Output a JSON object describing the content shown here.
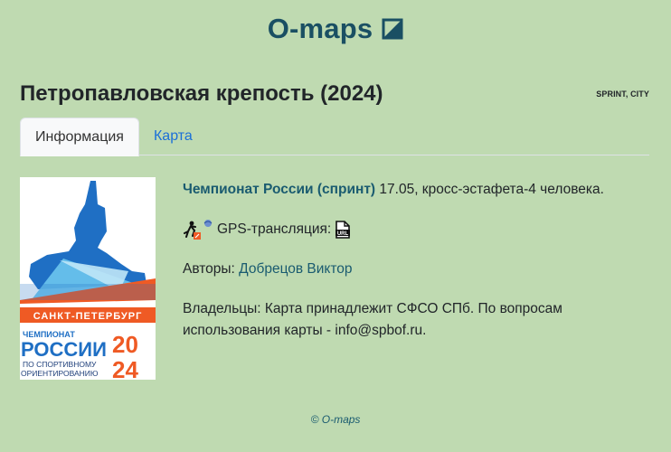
{
  "header": {
    "brand": "O-maps",
    "brand_icon": "half-square-icon"
  },
  "event": {
    "title": "Петропавловская крепость (2024)",
    "tags": "SPRINT, CITY"
  },
  "tabs": [
    {
      "label": "Информация",
      "active": true
    },
    {
      "label": "Карта",
      "active": false
    }
  ],
  "poster": {
    "city": "САНКТ-ПЕТЕРБУРГ",
    "line1": "ЧЕМПИОНАТ",
    "line2": "РОССИИ",
    "line3": "ПО СПОРТИВНОМУ",
    "line4": "ОРИЕНТИРОВАНИЮ",
    "year_top": "20",
    "year_bottom": "24",
    "colors": {
      "blue": "#1f6fc4",
      "orange": "#ef5a24",
      "light_blue": "#6cc5ee"
    }
  },
  "info": {
    "competition_link": "Чемпионат России (спринт)",
    "competition_rest": " 17.05, кросс-эстафета-4 человека.",
    "gps_label": "GPS-трансляция:",
    "authors_label": "Авторы: ",
    "authors_link": "Добрецов Виктор",
    "owners_text": "Владельцы: Карта принадлежит СФСО СПб. По вопросам использования карты - info@spbof.ru."
  },
  "footer": {
    "text": "© O-maps"
  }
}
